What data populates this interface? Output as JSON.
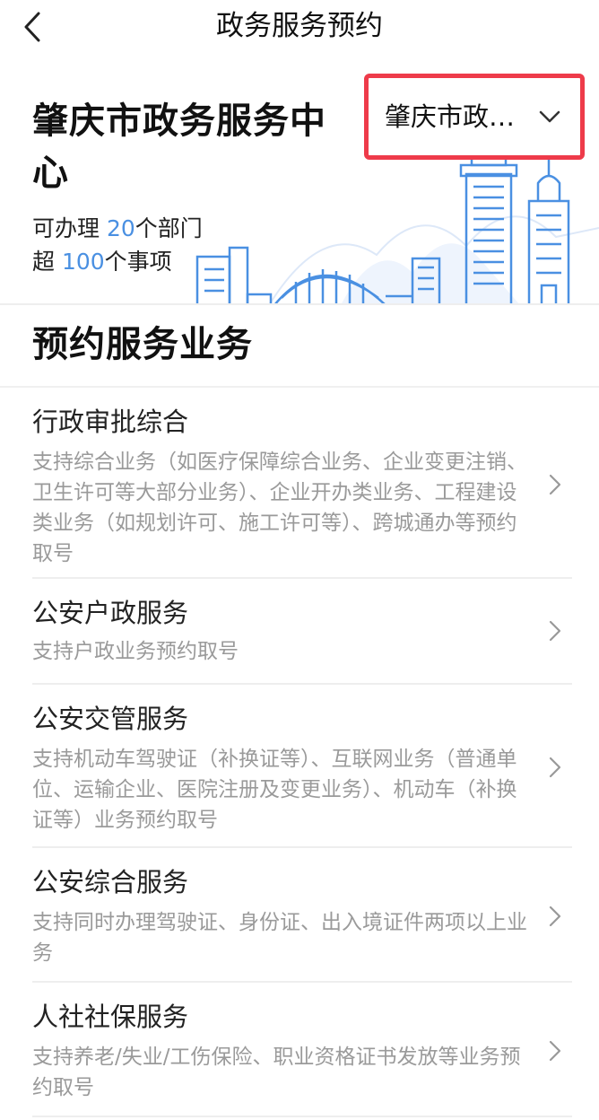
{
  "nav": {
    "title": "政务服务预约",
    "back_icon": "chevron-left-icon"
  },
  "hero": {
    "center_name": "肇庆市政务服务中心",
    "stats": {
      "line1_prefix": "可办理 ",
      "line1_number": "20",
      "line1_suffix": "个部门",
      "line2_prefix": "超 ",
      "line2_number": "100",
      "line2_suffix": "个事项"
    },
    "selector": {
      "value": "肇庆市政…",
      "icon": "chevron-down-icon",
      "highlight_color": "#ee3b4a"
    },
    "accent_color": "#4a90e2"
  },
  "section": {
    "title": "预约服务业务"
  },
  "services": [
    {
      "title": "行政审批综合",
      "desc": "支持综合业务（如医疗保障综合业务、企业变更注销、卫生许可等大部分业务）、企业开办类业务、工程建设类业务（如规划许可、施工许可等）、跨城通办等预约取号"
    },
    {
      "title": "公安户政服务",
      "desc": "支持户政业务预约取号"
    },
    {
      "title": "公安交管服务",
      "desc": "支持机动车驾驶证（补换证等）、互联网业务（普通单位、运输企业、医院注册及变更业务）、机动车（补换证等）业务预约取号"
    },
    {
      "title": "公安综合服务",
      "desc": "支持同时办理驾驶证、身份证、出入境证件两项以上业务"
    },
    {
      "title": "人社社保服务",
      "desc": "支持养老/失业/工伤保险、职业资格证书发放等业务预约取号"
    }
  ]
}
